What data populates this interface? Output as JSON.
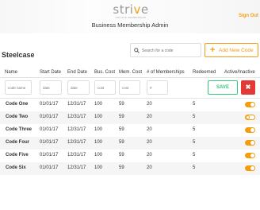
{
  "header": {
    "logo_text_main": "stri",
    "logo_text_accent": "v",
    "logo_text_end": "e",
    "logo_tagline": "PRIVATE MEMBERSHIP",
    "title": "Business Membership Admin",
    "signout_label": "Sign Out"
  },
  "company": {
    "name": "Steelcase"
  },
  "search": {
    "placeholder": "Search for a code",
    "icon": "search-icon"
  },
  "add_button": {
    "label": "Add New Code",
    "icon": "plus-icon"
  },
  "table": {
    "columns": [
      "Name",
      "Start Date",
      "End Date",
      "Bus. Cost",
      "Mem. Cost",
      "# of Memberships",
      "Redeemed",
      "Active/Inactive"
    ],
    "new_row": {
      "placeholders": [
        "code name",
        "date",
        "date",
        "cost",
        "cost",
        "#"
      ],
      "save_label": "SAVE",
      "cancel_label": "✖"
    },
    "rows": [
      {
        "name": "Code One",
        "start": "01/01/17",
        "end": "12/31/17",
        "bus_cost": "100",
        "mem_cost": "59",
        "memberships": "20",
        "redeemed": "5",
        "active": true
      },
      {
        "name": "Code Two",
        "start": "01/01/17",
        "end": "12/31/17",
        "bus_cost": "100",
        "mem_cost": "59",
        "memberships": "20",
        "redeemed": "5",
        "active": false
      },
      {
        "name": "Code Three",
        "start": "01/01/17",
        "end": "12/31/17",
        "bus_cost": "100",
        "mem_cost": "59",
        "memberships": "20",
        "redeemed": "5",
        "active": true
      },
      {
        "name": "Code Four",
        "start": "01/01/17",
        "end": "12/31/17",
        "bus_cost": "100",
        "mem_cost": "59",
        "memberships": "20",
        "redeemed": "5",
        "active": true
      },
      {
        "name": "Code Five",
        "start": "01/01/17",
        "end": "12/31/17",
        "bus_cost": "100",
        "mem_cost": "59",
        "memberships": "20",
        "redeemed": "5",
        "active": true
      },
      {
        "name": "Code Six",
        "start": "01/01/17",
        "end": "12/31/17",
        "bus_cost": "100",
        "mem_cost": "59",
        "memberships": "20",
        "redeemed": "5",
        "active": true
      }
    ]
  },
  "colors": {
    "accent": "#f39c12",
    "save": "#2ecc71",
    "cancel": "#e53935"
  }
}
